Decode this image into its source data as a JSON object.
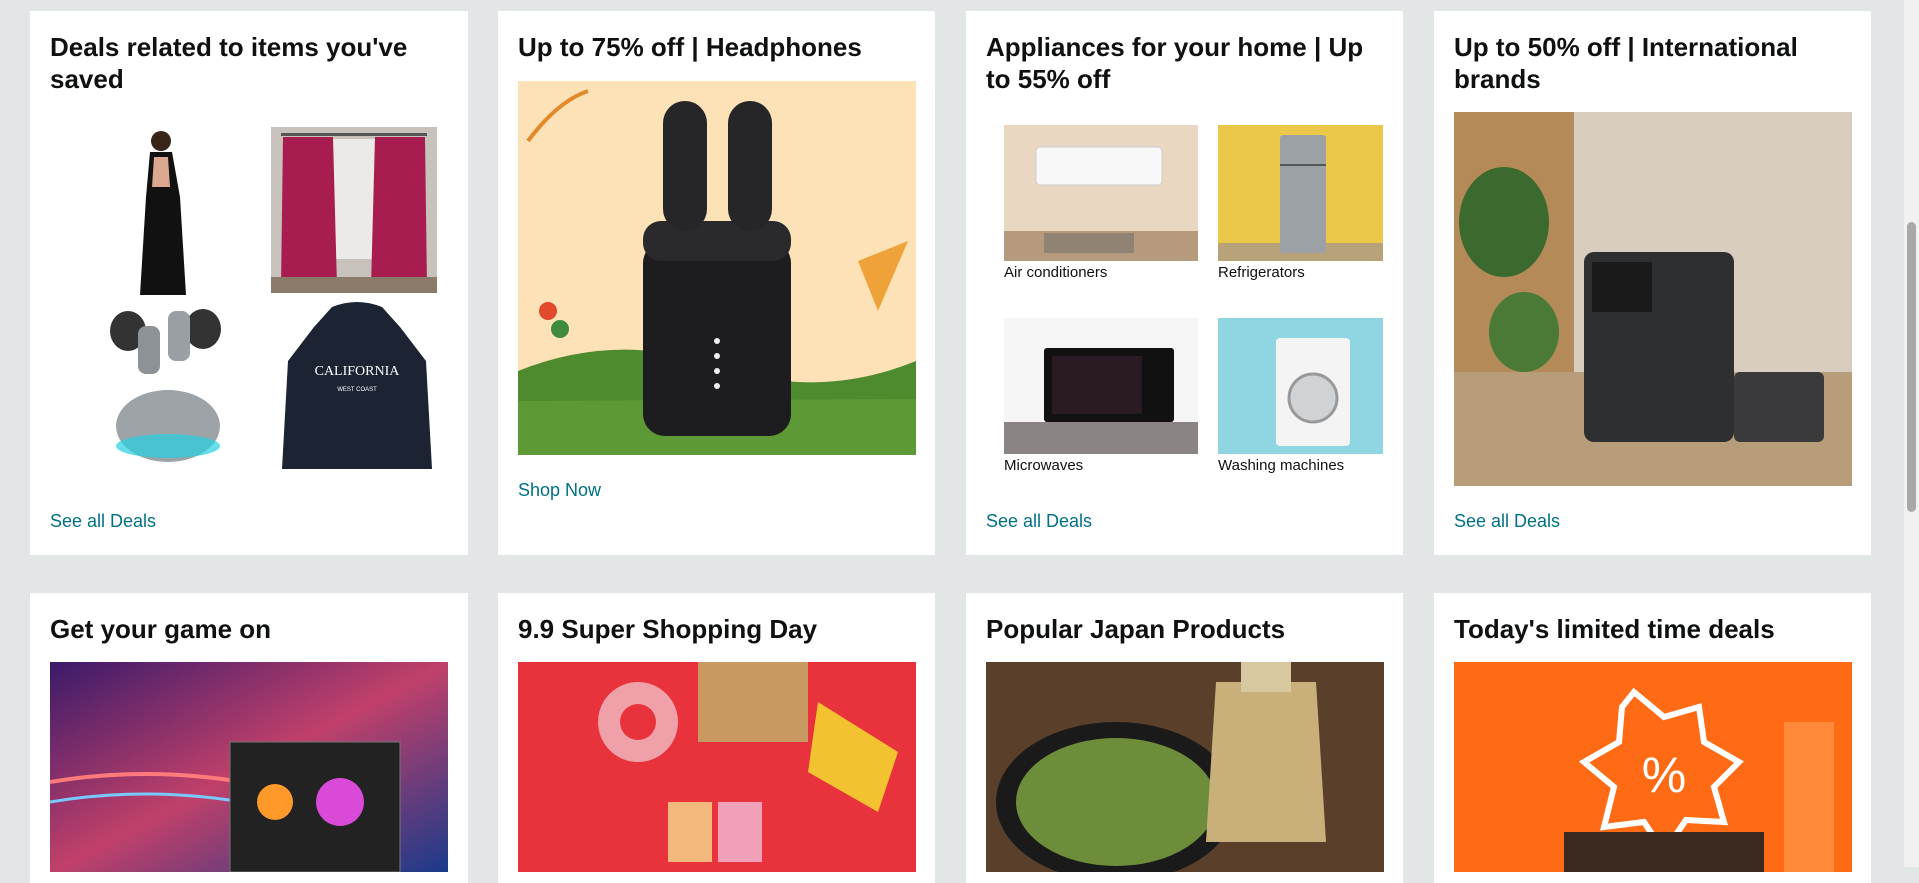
{
  "cards": {
    "saved": {
      "title": "Deals related to items you've saved",
      "link": "See all Deals",
      "items": [
        "saree",
        "curtains",
        "earbuds",
        "hoodie"
      ]
    },
    "headphones": {
      "title": "Up to 75% off | Headphones",
      "link": "Shop Now"
    },
    "appliances": {
      "title": "Appliances for your home | Up to 55% off",
      "link": "See all Deals",
      "items": [
        {
          "label": "Air conditioners"
        },
        {
          "label": "Refrigerators"
        },
        {
          "label": "Microwaves"
        },
        {
          "label": "Washing machines"
        }
      ]
    },
    "international": {
      "title": "Up to 50% off | International brands",
      "link": "See all Deals"
    },
    "game": {
      "title": "Get your game on"
    },
    "super": {
      "title": "9.9 Super Shopping Day"
    },
    "japan": {
      "title": "Popular Japan Products"
    },
    "limited": {
      "title": "Today's limited time deals"
    }
  },
  "colors": {
    "background": "#e3e6e6",
    "link": "#007185",
    "title": "#0f1111"
  }
}
